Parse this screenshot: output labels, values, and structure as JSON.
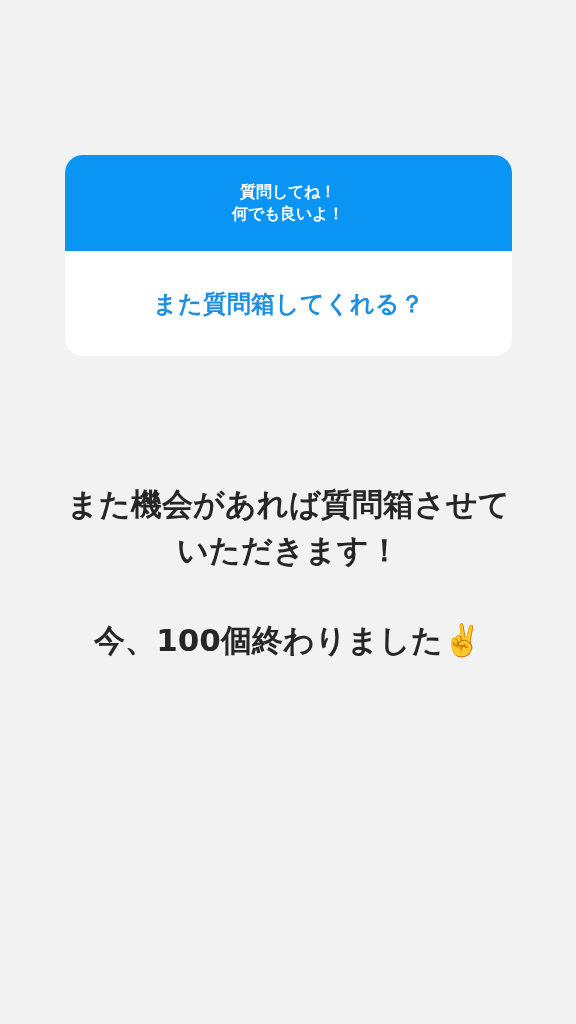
{
  "question_sticker": {
    "prompt_lines": [
      "質問してね！",
      "何でも良いよ！"
    ],
    "answer": "また質問箱してくれる？"
  },
  "message": [
    {
      "lines": [
        "また機会があれば質問箱させて",
        "いただきます！"
      ]
    },
    {
      "lines": [
        "今、100個終わりました✌️"
      ]
    }
  ]
}
